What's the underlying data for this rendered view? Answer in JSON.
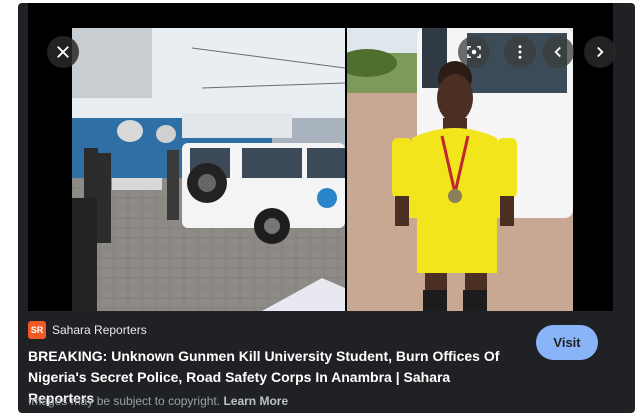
{
  "image": {
    "left_photo_desc": "accident-scene",
    "right_photo_desc": "student-portrait"
  },
  "controls": {
    "close_icon": "close-icon",
    "lens_icon": "lens-icon",
    "more_icon": "more-vertical-icon",
    "prev_icon": "chevron-left-icon",
    "next_icon": "chevron-right-icon"
  },
  "source": {
    "logo_text": "SR",
    "name": "Sahara Reporters"
  },
  "result": {
    "title": "BREAKING: Unknown Gunmen Kill University Student, Burn Offices Of Nigeria's Secret Police, Road Safety Corps In Anambra | Sahara Reporters",
    "visit_label": "Visit"
  },
  "footer": {
    "notice": "Images may be subject to copyright.",
    "learn_more": "Learn More"
  },
  "colors": {
    "panel_bg": "#202124",
    "visit_bg": "#8ab4f8",
    "logo_bg": "#f05a28"
  }
}
